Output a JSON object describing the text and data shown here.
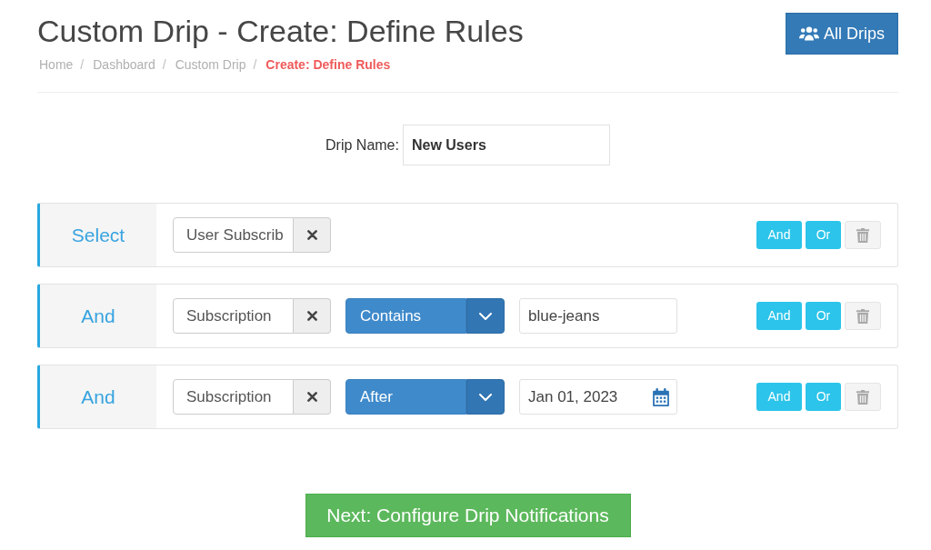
{
  "header": {
    "title": "Custom Drip - Create: Define Rules",
    "breadcrumb": [
      {
        "label": "Home",
        "active": false,
        "separator": "/"
      },
      {
        "label": "Dashboard",
        "active": false,
        "separator": "/"
      },
      {
        "label": "Custom Drip",
        "active": false,
        "separator": "/"
      },
      {
        "label": "Create: Define Rules",
        "active": true
      }
    ],
    "all_drips_button": {
      "label": "All Drips"
    }
  },
  "drip_name": {
    "label": "Drip Name:",
    "value": "New Users"
  },
  "rules": [
    {
      "kind": "field",
      "connector": "Select",
      "field": "User Subscrib",
      "and_button": "And",
      "or_button": "Or",
      "delete_disabled": true
    },
    {
      "kind": "text",
      "connector": "And",
      "field": "Subscription",
      "operator": "Contains",
      "value": "blue-jeans",
      "and_button": "And",
      "or_button": "Or",
      "delete_disabled": true
    },
    {
      "kind": "date",
      "connector": "And",
      "field": "Subscription",
      "operator": "After",
      "value": "Jan 01, 2023",
      "and_button": "And",
      "or_button": "Or",
      "delete_disabled": true
    }
  ],
  "next_button": {
    "label": "Next: Configure Drip Notifications"
  }
}
